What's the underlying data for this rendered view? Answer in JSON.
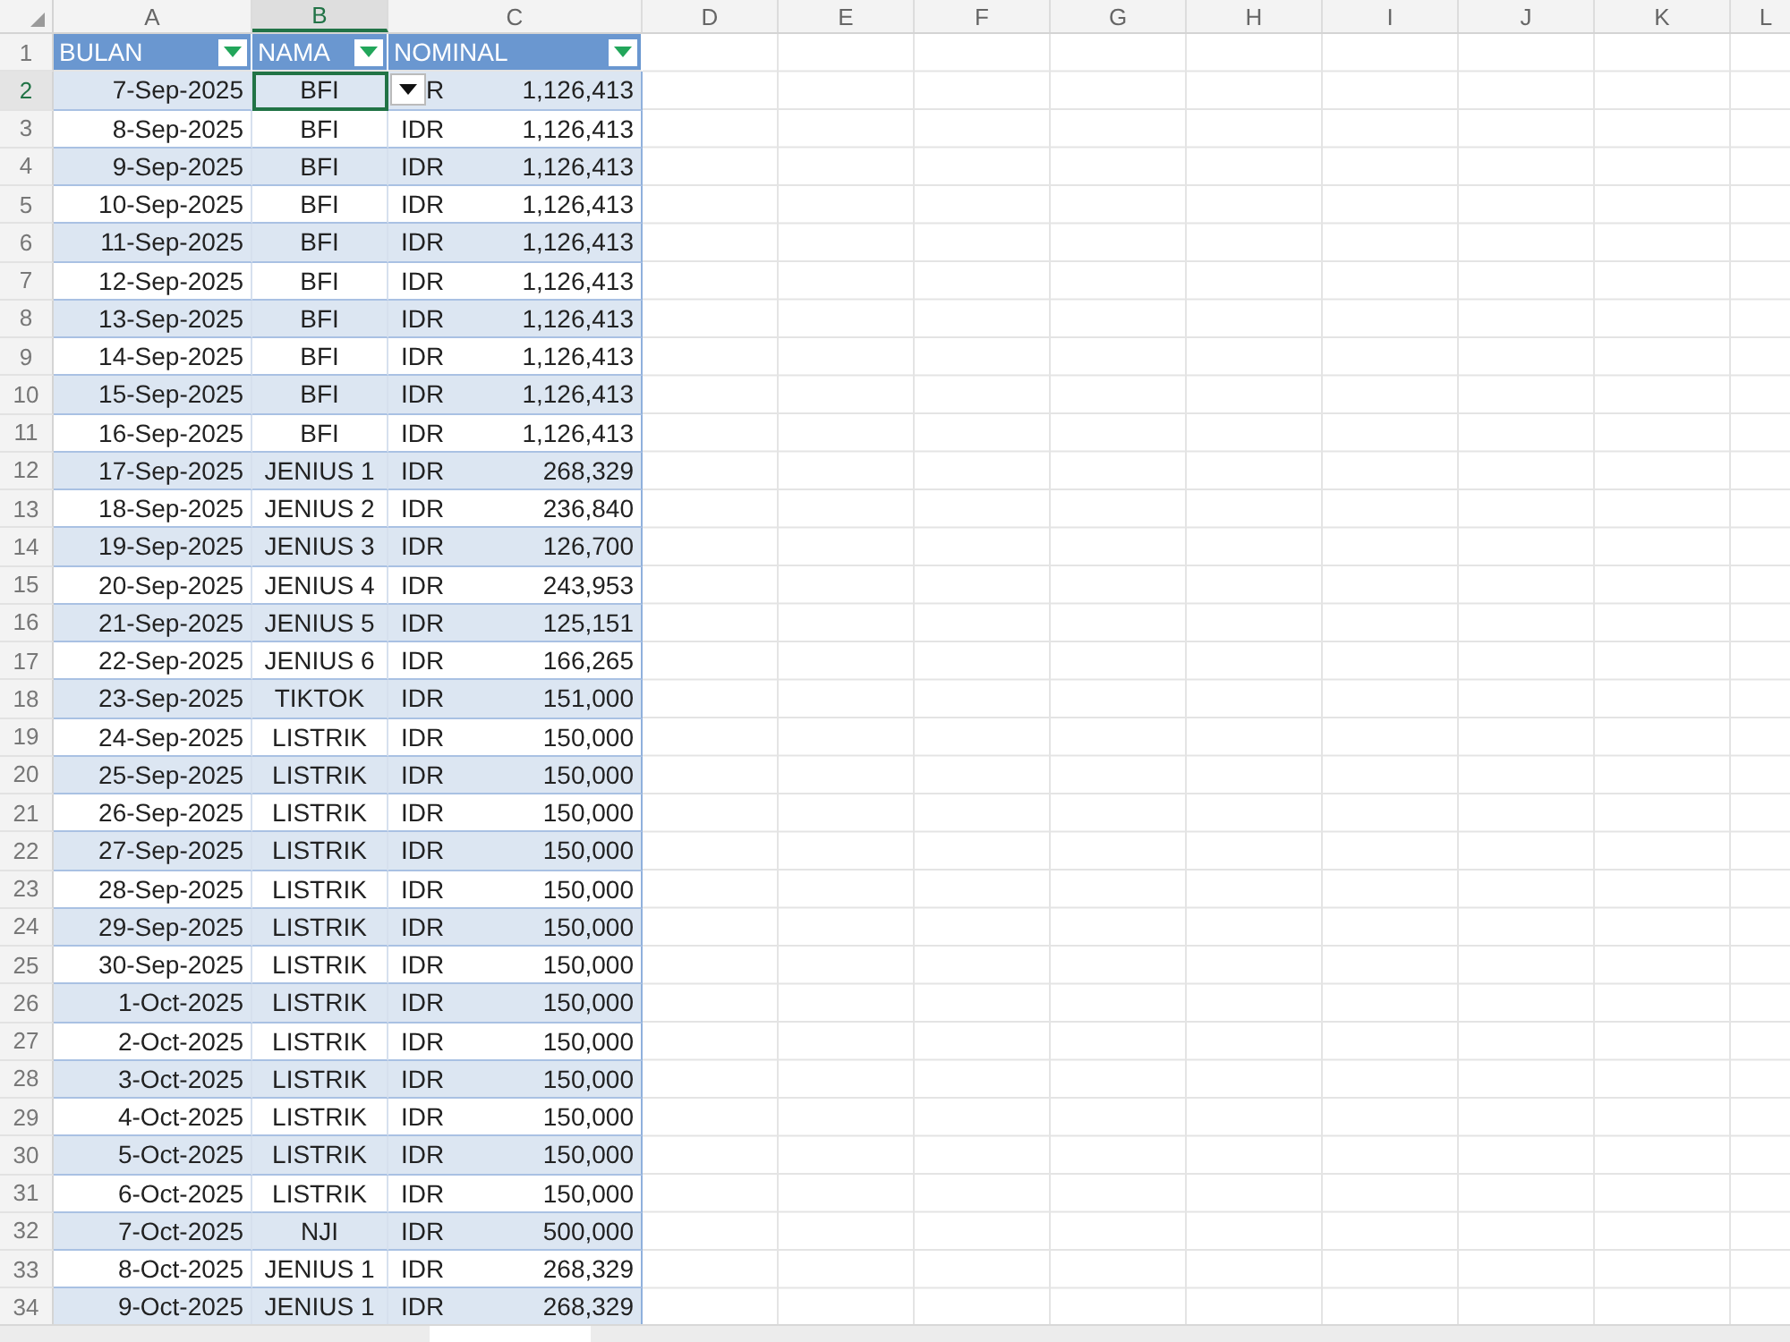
{
  "columns": [
    {
      "label": "A",
      "selected": false
    },
    {
      "label": "B",
      "selected": true
    },
    {
      "label": "C",
      "selected": false
    },
    {
      "label": "D",
      "selected": false
    },
    {
      "label": "E",
      "selected": false
    },
    {
      "label": "F",
      "selected": false
    },
    {
      "label": "G",
      "selected": false
    },
    {
      "label": "H",
      "selected": false
    },
    {
      "label": "I",
      "selected": false
    },
    {
      "label": "J",
      "selected": false
    },
    {
      "label": "K",
      "selected": false
    },
    {
      "label": "L",
      "selected": false
    }
  ],
  "header": {
    "number": "1",
    "cells": [
      "BULAN",
      "NAMA",
      "NOMINAL"
    ]
  },
  "rows": [
    {
      "number": "2",
      "date": "7-Sep-2025",
      "name": "BFI",
      "currency": "R",
      "amount": "1,126,413",
      "selected": true,
      "dropdown": true
    },
    {
      "number": "3",
      "date": "8-Sep-2025",
      "name": "BFI",
      "currency": "IDR",
      "amount": "1,126,413",
      "selected": false,
      "dropdown": false
    },
    {
      "number": "4",
      "date": "9-Sep-2025",
      "name": "BFI",
      "currency": "IDR",
      "amount": "1,126,413",
      "selected": false,
      "dropdown": false
    },
    {
      "number": "5",
      "date": "10-Sep-2025",
      "name": "BFI",
      "currency": "IDR",
      "amount": "1,126,413",
      "selected": false,
      "dropdown": false
    },
    {
      "number": "6",
      "date": "11-Sep-2025",
      "name": "BFI",
      "currency": "IDR",
      "amount": "1,126,413",
      "selected": false,
      "dropdown": false
    },
    {
      "number": "7",
      "date": "12-Sep-2025",
      "name": "BFI",
      "currency": "IDR",
      "amount": "1,126,413",
      "selected": false,
      "dropdown": false
    },
    {
      "number": "8",
      "date": "13-Sep-2025",
      "name": "BFI",
      "currency": "IDR",
      "amount": "1,126,413",
      "selected": false,
      "dropdown": false
    },
    {
      "number": "9",
      "date": "14-Sep-2025",
      "name": "BFI",
      "currency": "IDR",
      "amount": "1,126,413",
      "selected": false,
      "dropdown": false
    },
    {
      "number": "10",
      "date": "15-Sep-2025",
      "name": "BFI",
      "currency": "IDR",
      "amount": "1,126,413",
      "selected": false,
      "dropdown": false
    },
    {
      "number": "11",
      "date": "16-Sep-2025",
      "name": "BFI",
      "currency": "IDR",
      "amount": "1,126,413",
      "selected": false,
      "dropdown": false
    },
    {
      "number": "12",
      "date": "17-Sep-2025",
      "name": "JENIUS 1",
      "currency": "IDR",
      "amount": "268,329",
      "selected": false,
      "dropdown": false
    },
    {
      "number": "13",
      "date": "18-Sep-2025",
      "name": "JENIUS 2",
      "currency": "IDR",
      "amount": "236,840",
      "selected": false,
      "dropdown": false
    },
    {
      "number": "14",
      "date": "19-Sep-2025",
      "name": "JENIUS 3",
      "currency": "IDR",
      "amount": "126,700",
      "selected": false,
      "dropdown": false
    },
    {
      "number": "15",
      "date": "20-Sep-2025",
      "name": "JENIUS 4",
      "currency": "IDR",
      "amount": "243,953",
      "selected": false,
      "dropdown": false
    },
    {
      "number": "16",
      "date": "21-Sep-2025",
      "name": "JENIUS 5",
      "currency": "IDR",
      "amount": "125,151",
      "selected": false,
      "dropdown": false
    },
    {
      "number": "17",
      "date": "22-Sep-2025",
      "name": "JENIUS 6",
      "currency": "IDR",
      "amount": "166,265",
      "selected": false,
      "dropdown": false
    },
    {
      "number": "18",
      "date": "23-Sep-2025",
      "name": "TIKTOK",
      "currency": "IDR",
      "amount": "151,000",
      "selected": false,
      "dropdown": false
    },
    {
      "number": "19",
      "date": "24-Sep-2025",
      "name": "LISTRIK",
      "currency": "IDR",
      "amount": "150,000",
      "selected": false,
      "dropdown": false
    },
    {
      "number": "20",
      "date": "25-Sep-2025",
      "name": "LISTRIK",
      "currency": "IDR",
      "amount": "150,000",
      "selected": false,
      "dropdown": false
    },
    {
      "number": "21",
      "date": "26-Sep-2025",
      "name": "LISTRIK",
      "currency": "IDR",
      "amount": "150,000",
      "selected": false,
      "dropdown": false
    },
    {
      "number": "22",
      "date": "27-Sep-2025",
      "name": "LISTRIK",
      "currency": "IDR",
      "amount": "150,000",
      "selected": false,
      "dropdown": false
    },
    {
      "number": "23",
      "date": "28-Sep-2025",
      "name": "LISTRIK",
      "currency": "IDR",
      "amount": "150,000",
      "selected": false,
      "dropdown": false
    },
    {
      "number": "24",
      "date": "29-Sep-2025",
      "name": "LISTRIK",
      "currency": "IDR",
      "amount": "150,000",
      "selected": false,
      "dropdown": false
    },
    {
      "number": "25",
      "date": "30-Sep-2025",
      "name": "LISTRIK",
      "currency": "IDR",
      "amount": "150,000",
      "selected": false,
      "dropdown": false
    },
    {
      "number": "26",
      "date": "1-Oct-2025",
      "name": "LISTRIK",
      "currency": "IDR",
      "amount": "150,000",
      "selected": false,
      "dropdown": false
    },
    {
      "number": "27",
      "date": "2-Oct-2025",
      "name": "LISTRIK",
      "currency": "IDR",
      "amount": "150,000",
      "selected": false,
      "dropdown": false
    },
    {
      "number": "28",
      "date": "3-Oct-2025",
      "name": "LISTRIK",
      "currency": "IDR",
      "amount": "150,000",
      "selected": false,
      "dropdown": false
    },
    {
      "number": "29",
      "date": "4-Oct-2025",
      "name": "LISTRIK",
      "currency": "IDR",
      "amount": "150,000",
      "selected": false,
      "dropdown": false
    },
    {
      "number": "30",
      "date": "5-Oct-2025",
      "name": "LISTRIK",
      "currency": "IDR",
      "amount": "150,000",
      "selected": false,
      "dropdown": false
    },
    {
      "number": "31",
      "date": "6-Oct-2025",
      "name": "LISTRIK",
      "currency": "IDR",
      "amount": "150,000",
      "selected": false,
      "dropdown": false
    },
    {
      "number": "32",
      "date": "7-Oct-2025",
      "name": "NJI",
      "currency": "IDR",
      "amount": "500,000",
      "selected": false,
      "dropdown": false
    },
    {
      "number": "33",
      "date": "8-Oct-2025",
      "name": "JENIUS 1",
      "currency": "IDR",
      "amount": "268,329",
      "selected": false,
      "dropdown": false
    },
    {
      "number": "34",
      "date": "9-Oct-2025",
      "name": "JENIUS 1",
      "currency": "IDR",
      "amount": "268,329",
      "selected": false,
      "dropdown": false
    }
  ]
}
